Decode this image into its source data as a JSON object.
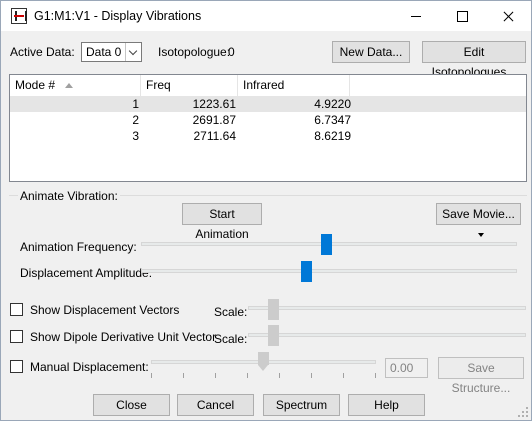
{
  "window": {
    "title": "G1:M1:V1 - Display Vibrations",
    "icon": "gaussview-app-icon"
  },
  "header": {
    "active_data_label": "Active Data:",
    "active_data_value": "Data 0",
    "isotopologue_label": "Isotopologue:",
    "isotopologue_value": "0",
    "new_data_button": "New Data...",
    "edit_isotopologues_button": "Edit Isotopologues..."
  },
  "table": {
    "columns": [
      "Mode #",
      "Freq",
      "Infrared"
    ],
    "rows": [
      {
        "mode": "1",
        "freq": "1223.61",
        "infrared": "4.9220",
        "selected": true
      },
      {
        "mode": "2",
        "freq": "2691.87",
        "infrared": "6.7347",
        "selected": false
      },
      {
        "mode": "3",
        "freq": "2711.64",
        "infrared": "8.6219",
        "selected": false
      }
    ]
  },
  "animate": {
    "group_title": "Animate Vibration:",
    "start_button": "Start Animation",
    "save_movie_button": "Save Movie...",
    "frequency_label": "Animation Frequency:",
    "frequency_level": 0.5,
    "amplitude_label": "Displacement Amplitude:",
    "amplitude_level": 0.43
  },
  "options": {
    "show_vectors_label": "Show Displacement Vectors",
    "show_dipole_label": "Show Dipole Derivative Unit Vector",
    "scale_label": "Scale:",
    "manual_label": "Manual Displacement:",
    "manual_value": "0.00",
    "save_structure_button": "Save Structure..."
  },
  "footer": {
    "close": "Close",
    "cancel": "Cancel",
    "spectrum": "Spectrum",
    "help": "Help"
  },
  "colors": {
    "accent": "#0078d7",
    "selection": "#e5e5e5",
    "disabled_text": "#838383"
  }
}
